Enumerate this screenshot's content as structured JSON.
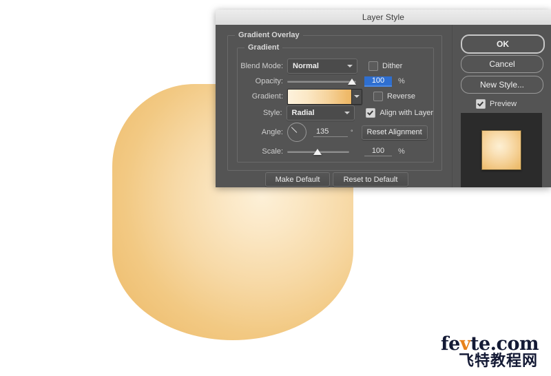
{
  "dialog": {
    "title": "Layer Style",
    "groups": {
      "outer_legend": "Gradient Overlay",
      "inner_legend": "Gradient"
    },
    "fields": {
      "blend_mode": {
        "label": "Blend Mode:",
        "value": "Normal"
      },
      "opacity": {
        "label": "Opacity:",
        "value": "100",
        "unit": "%",
        "slider_percent": 100,
        "selected": true
      },
      "gradient": {
        "label": "Gradient:",
        "swatch_from": "#fdf2dd",
        "swatch_to": "#edb765"
      },
      "style": {
        "label": "Style:",
        "value": "Radial"
      },
      "angle": {
        "label": "Angle:",
        "value": "135",
        "unit": "°"
      },
      "scale": {
        "label": "Scale:",
        "value": "100",
        "unit": "%",
        "slider_percent": 45
      }
    },
    "checkboxes": {
      "dither": {
        "label": "Dither",
        "checked": false
      },
      "reverse": {
        "label": "Reverse",
        "checked": false
      },
      "align_with_layer": {
        "label": "Align with Layer",
        "checked": true
      },
      "preview": {
        "label": "Preview",
        "checked": true
      }
    },
    "buttons": {
      "reset_alignment": "Reset Alignment",
      "make_default": "Make Default",
      "reset_to_default": "Reset to Default",
      "ok": "OK",
      "cancel": "Cancel",
      "new_style": "New Style..."
    }
  },
  "artwork": {
    "gradient_center": "#fdf0d7",
    "gradient_edge": "#edbb6b"
  },
  "watermark": {
    "line1_a": "fe",
    "line1_v": "v",
    "line1_b": "te.com",
    "line2": "飞特教程网",
    "accent_color": "#e8821a",
    "text_color": "#141a35"
  }
}
